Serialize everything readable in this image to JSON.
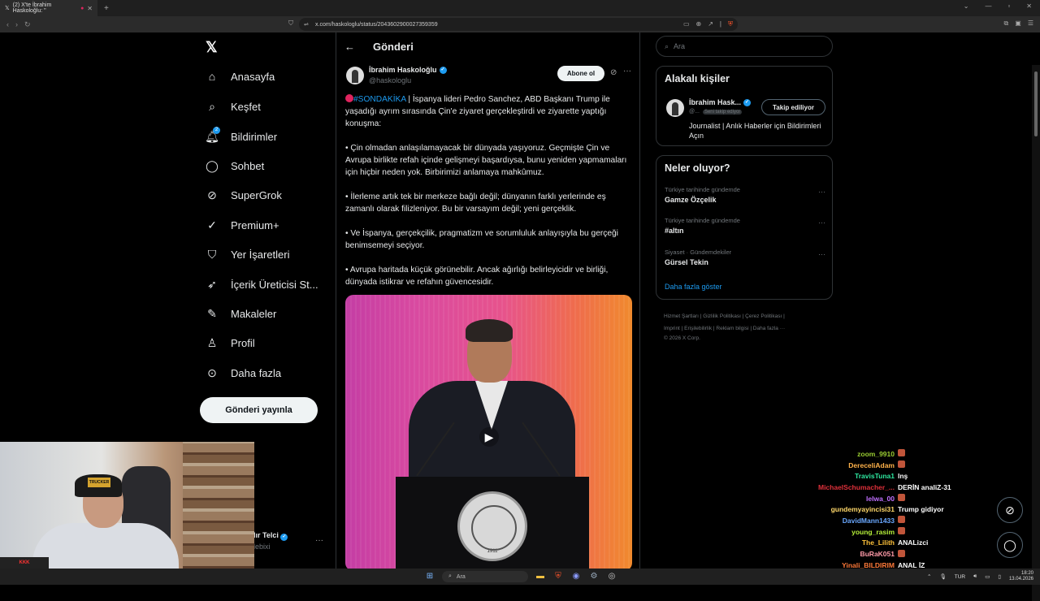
{
  "browser": {
    "tab_title": "(2) X'te İbrahim Haskoloğlu: \"",
    "url": "x.com/haskologlu/status/2043602900027359359"
  },
  "sidebar": {
    "items": [
      {
        "label": "Anasayfa",
        "icon": "home-icon"
      },
      {
        "label": "Keşfet",
        "icon": "search-icon"
      },
      {
        "label": "Bildirimler",
        "icon": "bell-icon",
        "badge": "2"
      },
      {
        "label": "Sohbet",
        "icon": "chat-icon"
      },
      {
        "label": "SuperGrok",
        "icon": "grok-icon"
      },
      {
        "label": "Premium+",
        "icon": "premium-icon"
      },
      {
        "label": "Yer İşaretleri",
        "icon": "bookmark-icon"
      },
      {
        "label": "İçerik Üreticisi St...",
        "icon": "rocket-icon"
      },
      {
        "label": "Makaleler",
        "icon": "article-icon"
      },
      {
        "label": "Profil",
        "icon": "profile-icon"
      },
      {
        "label": "Daha fazla",
        "icon": "more-circle-icon"
      }
    ],
    "post_button": "Gönderi yayınla",
    "account_name": "lır Telci",
    "account_handle": "lebixi"
  },
  "main": {
    "header": "Gönderi",
    "author_name": "İbrahim Haskoloğlu",
    "author_handle": "@haskologlu",
    "subscribe": "Abone ol",
    "hashtag": "#SONDAKİKA",
    "tweet_intro": " | İspanya lideri Pedro Sanchez, ABD Başkanı Trump ile yaşadığı ayrım sırasında Çin'e ziyaret gerçekleştirdi ve ziyarette yaptığı konuşma:",
    "paragraphs": [
      "• Çin olmadan anlaşılamayacak bir dünyada yaşıyoruz. Geçmişte Çin ve Avrupa birlikte refah içinde gelişmeyi başardıysa, bunu yeniden yapmamaları için hiçbir neden yok. Birbirimizi anlamaya mahkûmuz.",
      "• İlerleme artık tek bir merkeze bağlı değil; dünyanın farklı yerlerinde eş zamanlı olarak filizleniyor. Bu bir varsayım değil; yeni gerçeklik.",
      "• Ve İspanya, gerçekçilik, pragmatizm ve sorumluluk anlayışıyla bu gerçeği benimsemeyi seçiyor.",
      "• Avrupa haritada küçük görünebilir. Ancak ağırlığı belirleyicidir ve birliği, dünyada istikrar ve refahın güvencesidir."
    ],
    "seal_year": "1911"
  },
  "right": {
    "search_placeholder": "Ara",
    "related_title": "Alakalı kişiler",
    "related_name": "İbrahim Hask...",
    "related_handle": "@...",
    "follows_you": "Seni takip ediyor",
    "follow_button": "Takip ediliyor",
    "related_bio": "Journalist | Anlık Haberler için Bildirimleri Açın",
    "trends_title": "Neler oluyor?",
    "trends": [
      {
        "category": "Türkiye tarihinde gündemde",
        "name": "Gamze Özçelik"
      },
      {
        "category": "Türkiye tarihinde gündemde",
        "name": "#altın"
      },
      {
        "category": "Siyaset · Gündemdekiler",
        "name": "Gürsel Tekin"
      }
    ],
    "show_more": "Daha fazla göster",
    "footer_line1": "Hizmet Şartları  |  Gizlilik Politikası  |  Çerez Politikası  |",
    "footer_line2": "Imprint  |  Erişilebilirlik  |  Reklam bilgisi  |  Daha fazla ···",
    "footer_line3": "© 2026 X Corp."
  },
  "chat": [
    {
      "user": "zoom_9910",
      "color": "#9acd32",
      "msg": "",
      "emote": true
    },
    {
      "user": "DereceliAdam",
      "color": "#ffb24a",
      "msg": "",
      "emote": true
    },
    {
      "user": "TravisTuna1",
      "color": "#2ee8a0",
      "msg": "lnş",
      "emote": false
    },
    {
      "user": "MichaelSchumacher_...",
      "color": "#e0303a",
      "msg": "DERİN analiZ-31",
      "emote": false
    },
    {
      "user": "lelwa_00",
      "color": "#c070ff",
      "msg": "",
      "emote": true
    },
    {
      "user": "gundemyayincisi31",
      "color": "#ffd86a",
      "msg": "Trump gidiyor",
      "emote": false
    },
    {
      "user": "DavidMann1433",
      "color": "#6aa8ff",
      "msg": "",
      "emote": true
    },
    {
      "user": "young_rasim",
      "color": "#b6f03a",
      "msg": "",
      "emote": true
    },
    {
      "user": "The_Lilith",
      "color": "#ffc23a",
      "msg": "ANALizci",
      "emote": false
    },
    {
      "user": "BuRaK051",
      "color": "#ff9aa8",
      "msg": "",
      "emote": true
    },
    {
      "user": "Yinali_BILDIRIM",
      "color": "#ff7a3a",
      "msg": "ANAL İZ",
      "emote": false
    }
  ],
  "taskbar": {
    "search": "Ara",
    "lang": "TUR",
    "time": "18:20",
    "date": "13.04.2026"
  },
  "webcam": {
    "cap_text": "TRUCKER"
  }
}
